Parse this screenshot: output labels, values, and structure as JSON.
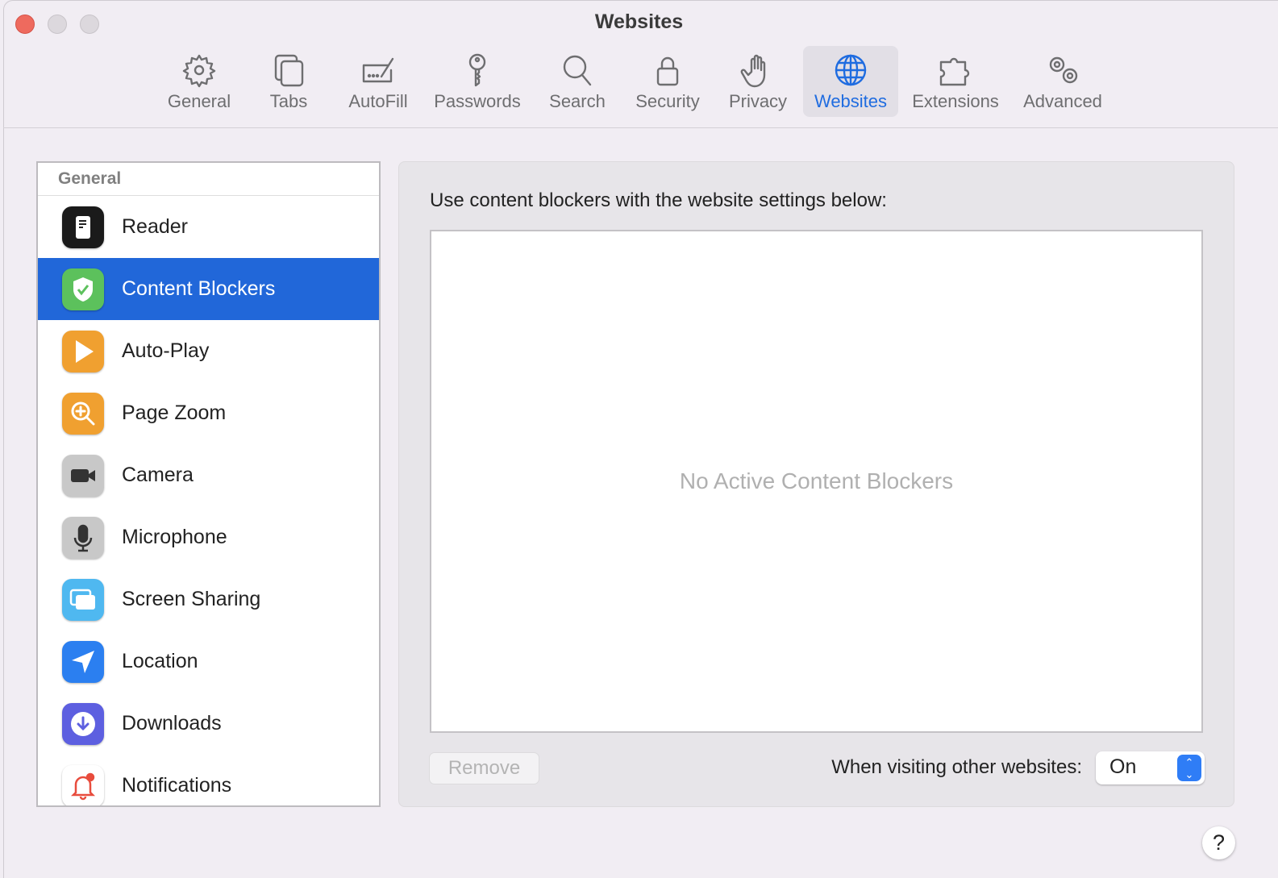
{
  "window": {
    "title": "Websites"
  },
  "toolbar": [
    {
      "label": "General",
      "icon": "gear-icon"
    },
    {
      "label": "Tabs",
      "icon": "tabs-icon"
    },
    {
      "label": "AutoFill",
      "icon": "autofill-icon"
    },
    {
      "label": "Passwords",
      "icon": "key-icon"
    },
    {
      "label": "Search",
      "icon": "search-icon"
    },
    {
      "label": "Security",
      "icon": "lock-icon"
    },
    {
      "label": "Privacy",
      "icon": "hand-icon"
    },
    {
      "label": "Websites",
      "icon": "globe-icon",
      "active": true
    },
    {
      "label": "Extensions",
      "icon": "puzzle-icon"
    },
    {
      "label": "Advanced",
      "icon": "gears-icon"
    }
  ],
  "sidebar": {
    "header": "General",
    "items": [
      {
        "label": "Reader",
        "icon": "reader-icon",
        "color": "#1a1a1a"
      },
      {
        "label": "Content Blockers",
        "icon": "shield-check-icon",
        "color": "#5cc15c",
        "selected": true
      },
      {
        "label": "Auto-Play",
        "icon": "play-icon",
        "color": "#f0a030"
      },
      {
        "label": "Page Zoom",
        "icon": "zoom-icon",
        "color": "#f0a030"
      },
      {
        "label": "Camera",
        "icon": "camera-icon",
        "color": "#c8c8c8"
      },
      {
        "label": "Microphone",
        "icon": "microphone-icon",
        "color": "#c8c8c8"
      },
      {
        "label": "Screen Sharing",
        "icon": "screen-sharing-icon",
        "color": "#4fb8f0"
      },
      {
        "label": "Location",
        "icon": "location-icon",
        "color": "#2b7ff0"
      },
      {
        "label": "Downloads",
        "icon": "download-icon",
        "color": "#5d5fe0"
      },
      {
        "label": "Notifications",
        "icon": "bell-icon",
        "color": "#ffffff"
      }
    ]
  },
  "main": {
    "label": "Use content blockers with the website settings below:",
    "empty_text": "No Active Content Blockers",
    "remove_label": "Remove",
    "other_label": "When visiting other websites:",
    "other_value": "On",
    "help": "?"
  },
  "colors": {
    "accent": "#1f6ce0",
    "selection": "#2167d9"
  }
}
